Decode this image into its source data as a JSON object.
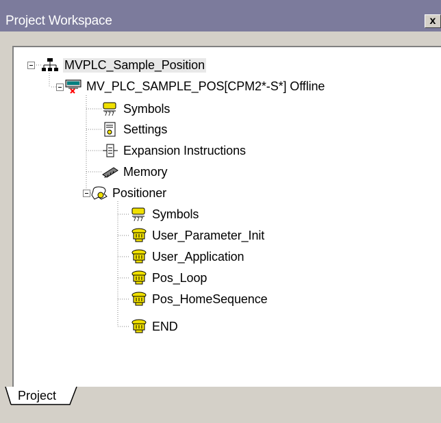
{
  "window": {
    "title": "Project Workspace",
    "close_glyph": "x"
  },
  "tree": {
    "root": {
      "label": "MVPLC_Sample_Position",
      "icon": "network-icon"
    },
    "plc": {
      "label": "MV_PLC_SAMPLE_POS[CPM2*-S*] Offline",
      "icon": "plc-offline-icon"
    },
    "plc_children": [
      {
        "label": "Symbols",
        "icon": "symbols-icon"
      },
      {
        "label": "Settings",
        "icon": "settings-icon"
      },
      {
        "label": "Expansion Instructions",
        "icon": "expansion-instructions-icon"
      },
      {
        "label": "Memory",
        "icon": "memory-icon"
      }
    ],
    "positioner": {
      "label": "Positioner",
      "icon": "program-icon"
    },
    "positioner_children": [
      {
        "label": "Symbols",
        "icon": "symbols-icon"
      },
      {
        "label": "User_Parameter_Init",
        "icon": "section-icon"
      },
      {
        "label": "User_Application",
        "icon": "section-icon"
      },
      {
        "label": "Pos_Loop",
        "icon": "section-icon"
      },
      {
        "label": "Pos_HomeSequence",
        "icon": "section-icon"
      },
      {
        "label": "END",
        "icon": "section-icon"
      }
    ]
  },
  "tabs": [
    {
      "label": "Project"
    }
  ],
  "colors": {
    "titlebar": "#7c7b9c",
    "background": "#d4d0c8",
    "tree_background": "#ffffff",
    "section_icon": "#f0e000"
  }
}
